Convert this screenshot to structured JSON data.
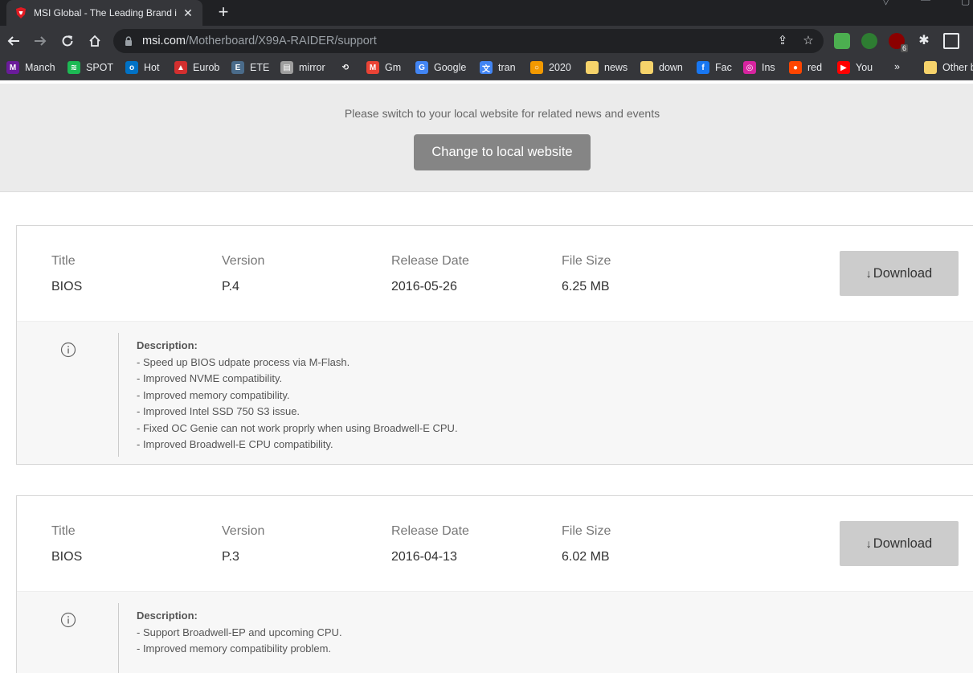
{
  "browser": {
    "tab_title": "MSI Global - The Leading Brand in H",
    "url_host": "msi.com",
    "url_path": "/Motherboard/X99A-RAIDER/support",
    "extension_badge": "6",
    "bookmarks": [
      {
        "label": "Manch",
        "icon_color": "#6a1b9a",
        "glyph": "M"
      },
      {
        "label": "SPOT",
        "icon_color": "#1db954",
        "glyph": "≋"
      },
      {
        "label": "Hot",
        "icon_color": "#0072c6",
        "glyph": "o"
      },
      {
        "label": "Eurob",
        "icon_color": "#d32f2f",
        "glyph": "▲"
      },
      {
        "label": "ETE",
        "icon_color": "#4a6b8a",
        "glyph": "E"
      },
      {
        "label": "mirror",
        "icon_color": "#9e9e9e",
        "glyph": "▤"
      },
      {
        "label": "",
        "icon_color": "#35363a",
        "glyph": "⟲"
      },
      {
        "label": "Gm",
        "icon_color": "#ea4335",
        "glyph": "M"
      },
      {
        "label": "Google",
        "icon_color": "#4285f4",
        "glyph": "G"
      },
      {
        "label": "tran",
        "icon_color": "#4285f4",
        "glyph": "文"
      },
      {
        "label": "2020",
        "icon_color": "#f29900",
        "glyph": "○"
      },
      {
        "label": "news",
        "icon_color": "#f6d36b",
        "glyph": ""
      },
      {
        "label": "down",
        "icon_color": "#f6d36b",
        "glyph": ""
      },
      {
        "label": "Fac",
        "icon_color": "#1877f2",
        "glyph": "f"
      },
      {
        "label": "Ins",
        "icon_color": "#d6249f",
        "glyph": "◎"
      },
      {
        "label": "red",
        "icon_color": "#ff4500",
        "glyph": "●"
      },
      {
        "label": "You",
        "icon_color": "#ff0000",
        "glyph": "▶"
      },
      {
        "label": "»",
        "icon_color": "#35363a",
        "glyph": ""
      },
      {
        "label": "Other b",
        "icon_color": "#f6d36b",
        "glyph": ""
      }
    ]
  },
  "banner": {
    "message": "Please switch to your local website for related news and events",
    "button_label": "Change to local website"
  },
  "downloads": [
    {
      "title_label": "Title",
      "title": "BIOS",
      "version_label": "Version",
      "version": "P.4",
      "date_label": "Release Date",
      "date": "2016-05-26",
      "size_label": "File Size",
      "size": "6.25 MB",
      "download_label": "Download",
      "description_title": "Description:",
      "description": [
        "- Speed up BIOS udpate process via M-Flash.",
        "- Improved NVME compatibility.",
        "- Improved memory compatibility.",
        "- Improved Intel SSD 750 S3 issue.",
        "- Fixed OC Genie can not work proprly when using Broadwell-E CPU.",
        "- Improved Broadwell-E CPU compatibility."
      ]
    },
    {
      "title_label": "Title",
      "title": "BIOS",
      "version_label": "Version",
      "version": "P.3",
      "date_label": "Release Date",
      "date": "2016-04-13",
      "size_label": "File Size",
      "size": "6.02 MB",
      "download_label": "Download",
      "description_title": "Description:",
      "description": [
        "- Support Broadwell-EP and upcoming CPU.",
        "- Improved memory compatibility problem."
      ]
    }
  ]
}
